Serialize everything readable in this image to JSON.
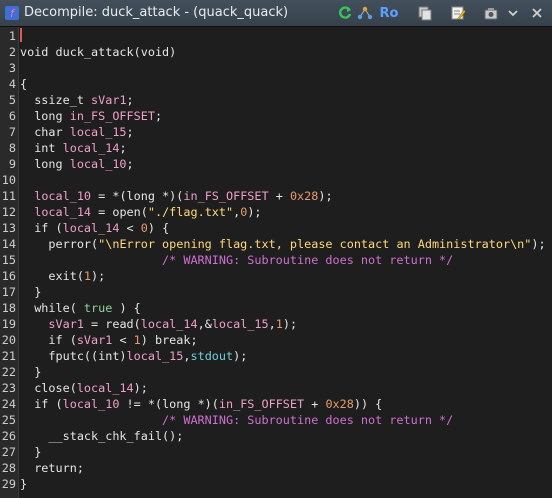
{
  "window": {
    "title": "Decompile: duck_attack - (quack_quack)",
    "toolbar": {
      "ro_label": "Ro"
    }
  },
  "code": {
    "lines": [
      {
        "n": "1",
        "tokens": []
      },
      {
        "n": "2",
        "tokens": [
          {
            "t": "void duck_attack(void)",
            "c": "fn"
          }
        ]
      },
      {
        "n": "3",
        "tokens": []
      },
      {
        "n": "4",
        "tokens": [
          {
            "t": "{",
            "c": "kw"
          }
        ]
      },
      {
        "n": "5",
        "tokens": [
          {
            "t": "  ssize_t ",
            "c": "kw"
          },
          {
            "t": "sVar1",
            "c": "var"
          },
          {
            "t": ";",
            "c": "kw"
          }
        ]
      },
      {
        "n": "6",
        "tokens": [
          {
            "t": "  long ",
            "c": "kw"
          },
          {
            "t": "in_FS_OFFSET",
            "c": "var"
          },
          {
            "t": ";",
            "c": "kw"
          }
        ]
      },
      {
        "n": "7",
        "tokens": [
          {
            "t": "  char ",
            "c": "kw"
          },
          {
            "t": "local_15",
            "c": "var"
          },
          {
            "t": ";",
            "c": "kw"
          }
        ]
      },
      {
        "n": "8",
        "tokens": [
          {
            "t": "  int ",
            "c": "kw"
          },
          {
            "t": "local_14",
            "c": "var"
          },
          {
            "t": ";",
            "c": "kw"
          }
        ]
      },
      {
        "n": "9",
        "tokens": [
          {
            "t": "  long ",
            "c": "kw"
          },
          {
            "t": "local_10",
            "c": "var"
          },
          {
            "t": ";",
            "c": "kw"
          }
        ]
      },
      {
        "n": "10",
        "tokens": []
      },
      {
        "n": "11",
        "tokens": [
          {
            "t": "  ",
            "c": "kw"
          },
          {
            "t": "local_10",
            "c": "var"
          },
          {
            "t": " = *(long *)(",
            "c": "kw"
          },
          {
            "t": "in_FS_OFFSET",
            "c": "var"
          },
          {
            "t": " + ",
            "c": "kw"
          },
          {
            "t": "0x28",
            "c": "num"
          },
          {
            "t": ");",
            "c": "kw"
          }
        ]
      },
      {
        "n": "12",
        "tokens": [
          {
            "t": "  ",
            "c": "kw"
          },
          {
            "t": "local_14",
            "c": "var"
          },
          {
            "t": " = open(",
            "c": "kw"
          },
          {
            "t": "\"./flag.txt\"",
            "c": "str"
          },
          {
            "t": ",",
            "c": "kw"
          },
          {
            "t": "0",
            "c": "num"
          },
          {
            "t": ");",
            "c": "kw"
          }
        ]
      },
      {
        "n": "13",
        "tokens": [
          {
            "t": "  if (",
            "c": "kw"
          },
          {
            "t": "local_14",
            "c": "var"
          },
          {
            "t": " < ",
            "c": "kw"
          },
          {
            "t": "0",
            "c": "num"
          },
          {
            "t": ") {",
            "c": "kw"
          }
        ]
      },
      {
        "n": "14",
        "tokens": [
          {
            "t": "    perror(",
            "c": "kw"
          },
          {
            "t": "\"\\nError opening flag.txt, please contact an Administrator\\n\"",
            "c": "str"
          },
          {
            "t": ");",
            "c": "kw"
          }
        ]
      },
      {
        "n": "15",
        "tokens": [
          {
            "t": "                    ",
            "c": "kw"
          },
          {
            "t": "/* WARNING: Subroutine does not return */",
            "c": "comment"
          }
        ]
      },
      {
        "n": "16",
        "tokens": [
          {
            "t": "    exit(",
            "c": "kw"
          },
          {
            "t": "1",
            "c": "num"
          },
          {
            "t": ");",
            "c": "kw"
          }
        ]
      },
      {
        "n": "17",
        "tokens": [
          {
            "t": "  }",
            "c": "kw"
          }
        ]
      },
      {
        "n": "18",
        "tokens": [
          {
            "t": "  while( ",
            "c": "kw"
          },
          {
            "t": "true",
            "c": "special"
          },
          {
            "t": " ) {",
            "c": "kw"
          }
        ]
      },
      {
        "n": "19",
        "tokens": [
          {
            "t": "    ",
            "c": "kw"
          },
          {
            "t": "sVar1",
            "c": "var"
          },
          {
            "t": " = read(",
            "c": "kw"
          },
          {
            "t": "local_14",
            "c": "var"
          },
          {
            "t": ",&",
            "c": "kw"
          },
          {
            "t": "local_15",
            "c": "var"
          },
          {
            "t": ",",
            "c": "kw"
          },
          {
            "t": "1",
            "c": "num"
          },
          {
            "t": ");",
            "c": "kw"
          }
        ]
      },
      {
        "n": "20",
        "tokens": [
          {
            "t": "    if (",
            "c": "kw"
          },
          {
            "t": "sVar1",
            "c": "var"
          },
          {
            "t": " < ",
            "c": "kw"
          },
          {
            "t": "1",
            "c": "num"
          },
          {
            "t": ") break;",
            "c": "kw"
          }
        ]
      },
      {
        "n": "21",
        "tokens": [
          {
            "t": "    fputc((int)",
            "c": "kw"
          },
          {
            "t": "local_15",
            "c": "var"
          },
          {
            "t": ",",
            "c": "kw"
          },
          {
            "t": "stdout",
            "c": "glob"
          },
          {
            "t": ");",
            "c": "kw"
          }
        ]
      },
      {
        "n": "22",
        "tokens": [
          {
            "t": "  }",
            "c": "kw"
          }
        ]
      },
      {
        "n": "23",
        "tokens": [
          {
            "t": "  close(",
            "c": "kw"
          },
          {
            "t": "local_14",
            "c": "var"
          },
          {
            "t": ");",
            "c": "kw"
          }
        ]
      },
      {
        "n": "24",
        "tokens": [
          {
            "t": "  if (",
            "c": "kw"
          },
          {
            "t": "local_10",
            "c": "var"
          },
          {
            "t": " != *(long *)(",
            "c": "kw"
          },
          {
            "t": "in_FS_OFFSET",
            "c": "var"
          },
          {
            "t": " + ",
            "c": "kw"
          },
          {
            "t": "0x28",
            "c": "num"
          },
          {
            "t": ")) {",
            "c": "kw"
          }
        ]
      },
      {
        "n": "25",
        "tokens": [
          {
            "t": "                    ",
            "c": "kw"
          },
          {
            "t": "/* WARNING: Subroutine does not return */",
            "c": "comment"
          }
        ]
      },
      {
        "n": "26",
        "tokens": [
          {
            "t": "    __stack_chk_fail();",
            "c": "kw"
          }
        ]
      },
      {
        "n": "27",
        "tokens": [
          {
            "t": "  }",
            "c": "kw"
          }
        ]
      },
      {
        "n": "28",
        "tokens": [
          {
            "t": "  return;",
            "c": "kw"
          }
        ]
      },
      {
        "n": "29",
        "tokens": [
          {
            "t": "}",
            "c": "kw"
          }
        ]
      }
    ]
  },
  "colors": {
    "variable": "#f0a0c8",
    "number": "#e89b6c",
    "string": "#ffd97a",
    "comment": "#d070d0",
    "global": "#6fd0d8",
    "cursor": "#e05555"
  }
}
